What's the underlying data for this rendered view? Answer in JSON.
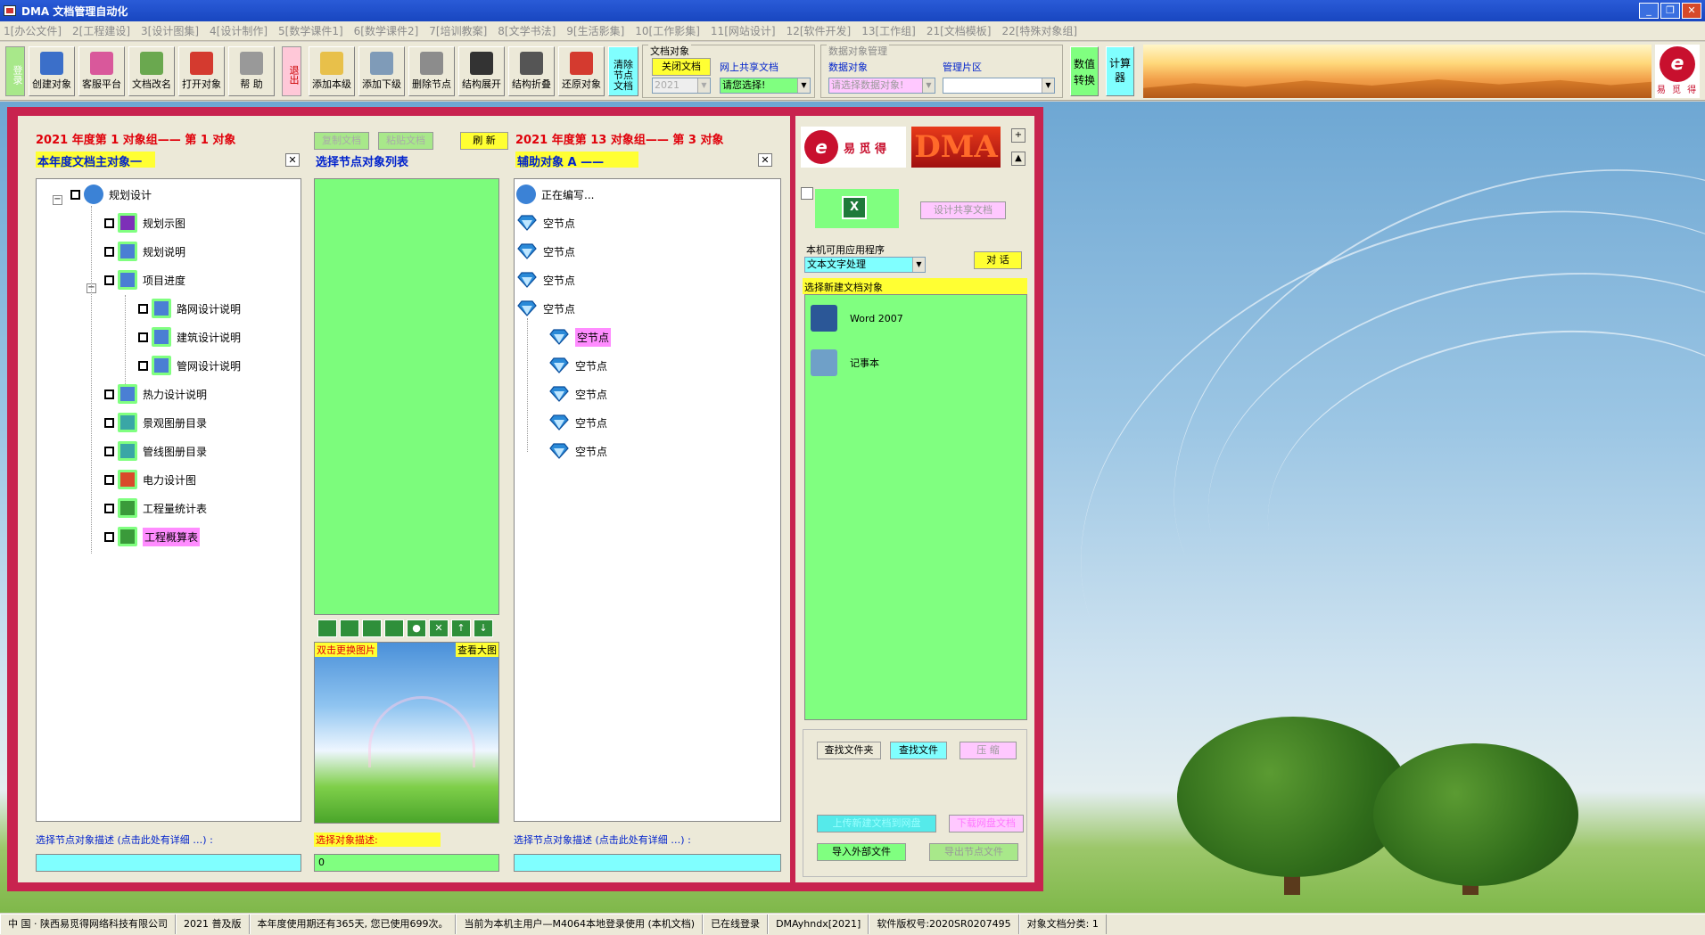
{
  "window": {
    "title": "DMA  文档管理自动化",
    "min": "_",
    "restore": "❐",
    "close": "✕"
  },
  "menu": [
    "1[办公文件]",
    "2[工程建设]",
    "3[设计图集]",
    "4[设计制作]",
    "5[数学课件1]",
    "6[数学课件2]",
    "7[培训教案]",
    "8[文学书法]",
    "9[生活影集]",
    "10[工作影集]",
    "11[网站设计]",
    "12[软件开发]",
    "13[工作组]",
    "21[文档模板]",
    "22[特殊对象组]"
  ],
  "toolbar": {
    "login": "登录",
    "exit": "退出",
    "buttons": [
      {
        "label": "创建对象",
        "color": "#3b6fc9"
      },
      {
        "label": "客服平台",
        "color": "#d9589b"
      },
      {
        "label": "文档改名",
        "color": "#6aa84f"
      },
      {
        "label": "打开对象",
        "color": "#d43a2f"
      },
      {
        "label": "帮 助",
        "color": "#999999"
      },
      {
        "label": "添加本级",
        "color": "#e8c04a"
      },
      {
        "label": "添加下级",
        "color": "#7f9bb8"
      },
      {
        "label": "删除节点",
        "color": "#8c8c8c"
      },
      {
        "label": "结构展开",
        "color": "#333333"
      },
      {
        "label": "结构折叠",
        "color": "#555555"
      },
      {
        "label": "还原对象",
        "color": "#d43a2f"
      }
    ],
    "clear_node": "清除节点文档",
    "doc_object": {
      "title": "文档对象",
      "close_doc": "关闭文档",
      "online_share": "网上共享文档",
      "year_value": "2021",
      "select_placeholder": "请您选择!"
    },
    "data_object": {
      "title": "数据对象管理",
      "data_object_label": "数据对象",
      "data_object_placeholder": "请选择数据对象!",
      "region_label": "管理片区",
      "region_value": ""
    },
    "convert": "数值转换",
    "calculator": "计算器",
    "logo_text": "易 觅 得"
  },
  "left": {
    "header1": "2021 年度第 1 对象组—— 第 1 对象",
    "sub1": "本年度文档主对象一",
    "copy_doc": "复制文档",
    "paste_doc": "粘贴文档",
    "refresh": "刷 新",
    "sub2": "选择节点对象列表",
    "header3": "2021 年度第 13 对象组—— 第 3 对象",
    "sub3": "辅助对象 A ——",
    "close_x": "✕",
    "tree": [
      {
        "label": "规划设计",
        "level": 0,
        "icon": "#3b82d6"
      },
      {
        "label": "规划示图",
        "level": 1,
        "icon": "#7d2fb8"
      },
      {
        "label": "规划说明",
        "level": 1,
        "icon": "#4a7fd4"
      },
      {
        "label": "项目进度",
        "level": 1,
        "icon": "#4a7fd4"
      },
      {
        "label": "路网设计说明",
        "level": 2,
        "icon": "#4a7fd4"
      },
      {
        "label": "建筑设计说明",
        "level": 2,
        "icon": "#4a7fd4"
      },
      {
        "label": "管网设计说明",
        "level": 2,
        "icon": "#4a7fd4"
      },
      {
        "label": "热力设计说明",
        "level": 1,
        "icon": "#4a7fd4"
      },
      {
        "label": "景观图册目录",
        "level": 1,
        "icon": "#3aa6a6"
      },
      {
        "label": "管线图册目录",
        "level": 1,
        "icon": "#3aa6a6"
      },
      {
        "label": "电力设计图",
        "level": 1,
        "icon": "#d94a2a"
      },
      {
        "label": "工程量统计表",
        "level": 1,
        "icon": "#3a9a3a"
      },
      {
        "label": "工程概算表",
        "level": 1,
        "icon": "#3a9a3a"
      }
    ],
    "aux_list": [
      {
        "label": "正在编写...",
        "level": 0
      },
      {
        "label": "空节点",
        "level": 0
      },
      {
        "label": "空节点",
        "level": 0
      },
      {
        "label": "空节点",
        "level": 0
      },
      {
        "label": "空节点",
        "level": 0
      },
      {
        "label": "空节点",
        "level": 1
      },
      {
        "label": "空节点",
        "level": 1
      },
      {
        "label": "空节点",
        "level": 1
      },
      {
        "label": "空节点",
        "level": 1
      },
      {
        "label": "空节点",
        "level": 1
      }
    ],
    "double_click_image": "双击更换图片",
    "view_large": "查看大图",
    "desc1": "选择节点对象描述 (点击此处有详细 …) :",
    "desc2": "选择对象描述:",
    "desc3": "选择节点对象描述 (点击此处有详细 …) :",
    "desc2_value": "0"
  },
  "right": {
    "logo_cn": "易 觅 得",
    "dma": "DMA",
    "design_share": "设计共享文档",
    "local_apps": "本机可用应用程序",
    "app_select": "文本文字处理",
    "dialog": "对 话",
    "new_doc_header": "选择新建文档对象",
    "apps": [
      {
        "label": "Word 2007",
        "icon": "#2b5797"
      },
      {
        "label": "记事本",
        "icon": "#6fa0c8"
      }
    ],
    "find_folder": "查找文件夹",
    "find_file": "查找文件",
    "compress": "压 缩",
    "upload": "上传新建文档到网盘",
    "download": "下载网盘文档",
    "import": "导入外部文件",
    "export": "导出节点文件",
    "plus": "+",
    "up": "▲"
  },
  "status": [
    "中  国 · 陕西易觅得网络科技有限公司",
    "2021 普及版",
    "本年度使用期还有365天, 您已使用699次。",
    "当前为本机主用户—M4064本地登录使用 (本机文档)",
    "已在线登录",
    "DMAyhndx[2021]",
    "软件版权号:2020SR0207495",
    "对象文档分类: 1"
  ]
}
